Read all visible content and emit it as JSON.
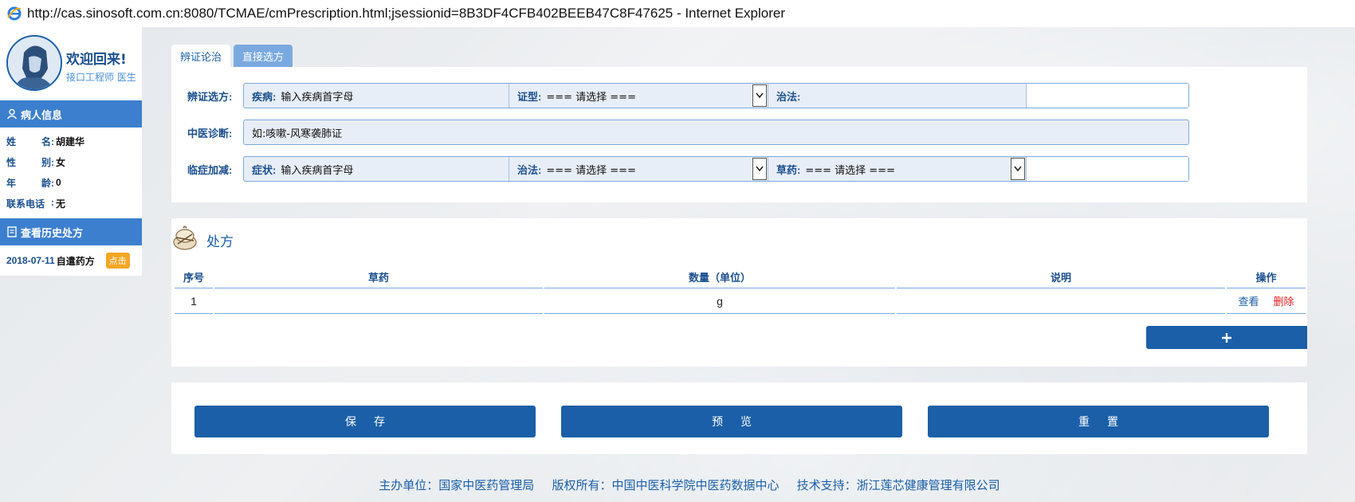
{
  "window": {
    "title": "http://cas.sinosoft.com.cn:8080/TCMAE/cmPrescription.html;jsessionid=8B3DF4CFB402BEEB47C8F47625 - Internet Explorer"
  },
  "sidebar": {
    "welcome": "欢迎回来!",
    "role": "接口工程师 医生",
    "patient_header": "病人信息",
    "patient": [
      {
        "label_a": "姓",
        "label_b": "名",
        "value": "胡建华"
      },
      {
        "label_a": "性",
        "label_b": "别",
        "value": "女"
      },
      {
        "label_a": "年",
        "label_b": "龄",
        "value": "0"
      },
      {
        "label_a": "联系电话",
        "label_b": "",
        "value": "无"
      }
    ],
    "history_header": "查看历史处方",
    "history": [
      {
        "date": "2018-07-11",
        "name": "自遣药方",
        "action": "点击"
      }
    ]
  },
  "tabs": [
    "辨证论治",
    "直接选方"
  ],
  "form": {
    "row1": {
      "label": "辨证选方:",
      "disease_label": "疾病:",
      "disease_value": "输入疾病首字母",
      "syndrome_label": "证型:",
      "syndrome_value": "=== 请选择 ===",
      "therapy_label": "治法:",
      "therapy_value": ""
    },
    "row2": {
      "label": "中医诊断:",
      "value": "如:咳嗽-风寒袭肺证"
    },
    "row3": {
      "label": "临症加减:",
      "symptom_label": "症状:",
      "symptom_value": "输入疾病首字母",
      "therapy_label": "治法:",
      "therapy_value": "=== 请选择 ===",
      "herb_label": "草药:",
      "herb_value": "=== 请选择 ==="
    }
  },
  "prescription": {
    "title": "处方",
    "columns": [
      "序号",
      "草药",
      "数量（单位）",
      "说明",
      "操作"
    ],
    "rows": [
      {
        "index": "1",
        "herb": "",
        "qty": "g",
        "note": "",
        "view": "查看",
        "delete": "删除"
      }
    ],
    "add_label": "+"
  },
  "actions": {
    "save": "保存",
    "preview": "预览",
    "reset": "重置"
  },
  "footer": {
    "host": "主办单位：国家中医药管理局",
    "copyright": "版权所有：中国中医科学院中医药数据中心",
    "support": "技术支持：浙江莲芯健康管理有限公司"
  },
  "colors": {
    "primary": "#1a5fa8",
    "sidebar_header": "#3c7fce",
    "badge": "#f5a623",
    "delete": "#e02020"
  }
}
